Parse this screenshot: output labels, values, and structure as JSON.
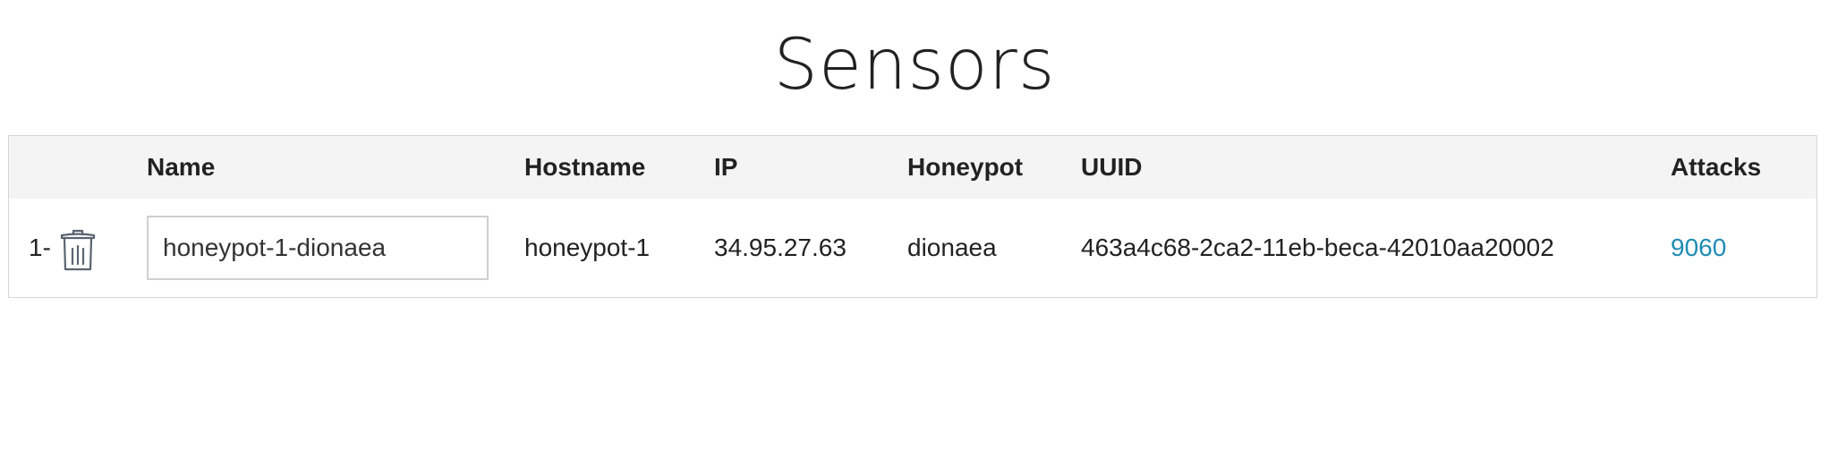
{
  "page": {
    "title": "Sensors"
  },
  "table": {
    "headers": {
      "name": "Name",
      "hostname": "Hostname",
      "ip": "IP",
      "honeypot": "Honeypot",
      "uuid": "UUID",
      "attacks": "Attacks"
    },
    "rows": [
      {
        "index": "1-",
        "delete_icon": "trash-icon",
        "name": "honeypot-1-dionaea",
        "hostname": "honeypot-1",
        "ip": "34.95.27.63",
        "honeypot": "dionaea",
        "uuid": "463a4c68-2ca2-11eb-beca-42010aa20002",
        "attacks": "9060"
      }
    ]
  },
  "colors": {
    "link": "#1f8bb4",
    "header_bg": "#f4f4f4",
    "border": "#d6d6d6"
  }
}
